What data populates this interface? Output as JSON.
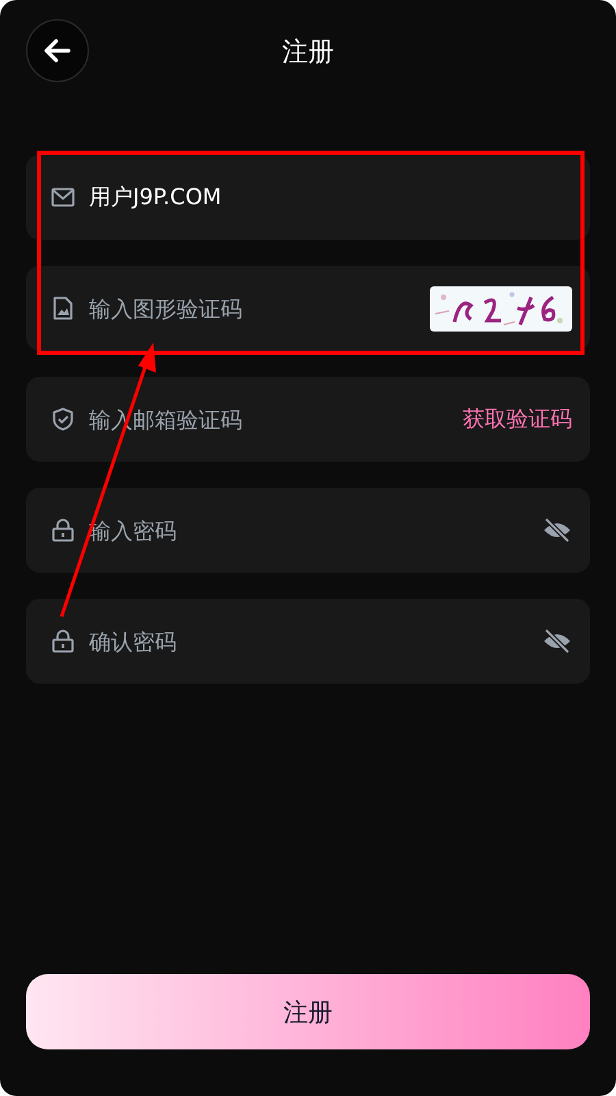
{
  "header": {
    "title": "注册"
  },
  "fields": [
    {
      "kind": "email",
      "value": "用户J9P.COM"
    },
    {
      "kind": "captcha",
      "placeholder": "输入图形验证码"
    },
    {
      "kind": "code",
      "placeholder": "输入邮箱验证码",
      "action": "获取验证码"
    },
    {
      "kind": "password",
      "placeholder": "输入密码"
    },
    {
      "kind": "password",
      "placeholder": "确认密码"
    }
  ],
  "submit": "注册"
}
